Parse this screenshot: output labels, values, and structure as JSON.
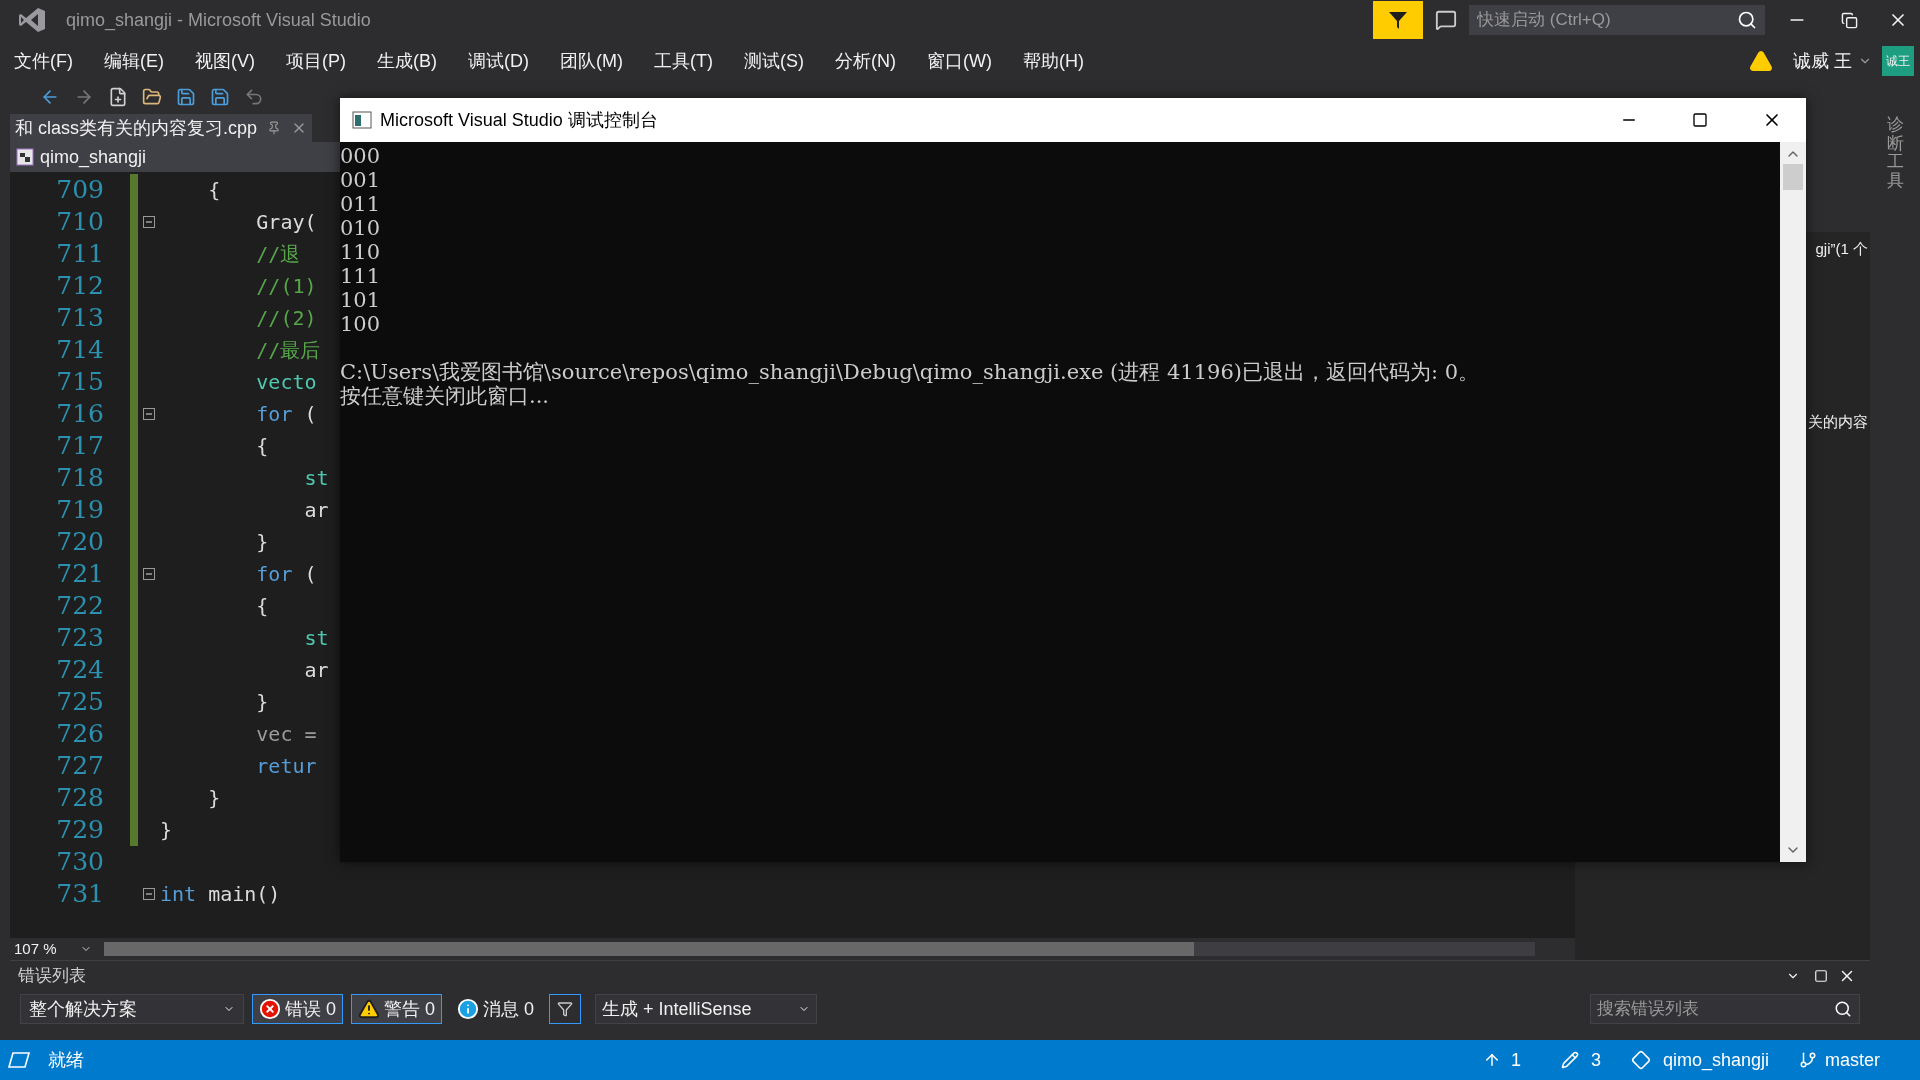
{
  "window": {
    "title": "qimo_shangji - Microsoft Visual Studio"
  },
  "quick_launch": {
    "placeholder": "快速启动 (Ctrl+Q)"
  },
  "menu": [
    "文件(F)",
    "编辑(E)",
    "视图(V)",
    "项目(P)",
    "生成(B)",
    "调试(D)",
    "团队(M)",
    "工具(T)",
    "测试(S)",
    "分析(N)",
    "窗口(W)",
    "帮助(H)"
  ],
  "user": {
    "name": "诚威 王",
    "avatar": "诚王"
  },
  "editor": {
    "tab": {
      "label": "和 class类有关的内容复习.cpp",
      "selected": true
    },
    "project": "qimo_shangji",
    "zoom": "107 %",
    "lines": [
      {
        "number": "709",
        "fold": false,
        "segments": [
          {
            "text": "    {",
            "kind": "plain"
          }
        ]
      },
      {
        "number": "710",
        "fold": true,
        "segments": [
          {
            "text": "        Gray(",
            "kind": "plain"
          }
        ]
      },
      {
        "number": "711",
        "fold": false,
        "segments": [
          {
            "text": "        //退",
            "kind": "comment"
          }
        ]
      },
      {
        "number": "712",
        "fold": false,
        "segments": [
          {
            "text": "        //(1)",
            "kind": "comment"
          }
        ]
      },
      {
        "number": "713",
        "fold": false,
        "segments": [
          {
            "text": "        //(2)",
            "kind": "comment"
          }
        ]
      },
      {
        "number": "714",
        "fold": false,
        "segments": [
          {
            "text": "        //最后",
            "kind": "comment"
          }
        ]
      },
      {
        "number": "715",
        "fold": false,
        "segments": [
          {
            "text": "        vecto",
            "kind": "type"
          }
        ]
      },
      {
        "number": "716",
        "fold": true,
        "segments": [
          {
            "text": "        for",
            "kind": "keyword"
          },
          {
            "text": " (",
            "kind": "plain"
          }
        ]
      },
      {
        "number": "717",
        "fold": false,
        "segments": [
          {
            "text": "        {",
            "kind": "plain"
          }
        ]
      },
      {
        "number": "718",
        "fold": false,
        "segments": [
          {
            "text": "            st",
            "kind": "type"
          }
        ]
      },
      {
        "number": "719",
        "fold": false,
        "segments": [
          {
            "text": "            ar",
            "kind": "plain"
          }
        ]
      },
      {
        "number": "720",
        "fold": false,
        "segments": [
          {
            "text": "        }",
            "kind": "plain"
          }
        ]
      },
      {
        "number": "721",
        "fold": true,
        "segments": [
          {
            "text": "        for",
            "kind": "keyword"
          },
          {
            "text": " (",
            "kind": "plain"
          }
        ]
      },
      {
        "number": "722",
        "fold": false,
        "segments": [
          {
            "text": "        {",
            "kind": "plain"
          }
        ]
      },
      {
        "number": "723",
        "fold": false,
        "segments": [
          {
            "text": "            st",
            "kind": "type"
          }
        ]
      },
      {
        "number": "724",
        "fold": false,
        "segments": [
          {
            "text": "            ar",
            "kind": "plain"
          }
        ]
      },
      {
        "number": "725",
        "fold": false,
        "segments": [
          {
            "text": "        }",
            "kind": "plain"
          }
        ]
      },
      {
        "number": "726",
        "fold": false,
        "segments": [
          {
            "text": "        vec =",
            "kind": "dim"
          }
        ]
      },
      {
        "number": "727",
        "fold": false,
        "segments": [
          {
            "text": "        retur",
            "kind": "keyword"
          }
        ]
      },
      {
        "number": "728",
        "fold": false,
        "segments": [
          {
            "text": "    }",
            "kind": "plain"
          }
        ]
      },
      {
        "number": "729",
        "fold": false,
        "segments": [
          {
            "text": "}",
            "kind": "plain"
          }
        ]
      },
      {
        "number": "730",
        "fold": false
      },
      {
        "number": "731",
        "fold": true,
        "segments": [
          {
            "text": "int",
            "kind": "keyword"
          },
          {
            "text": " main()",
            "kind": "plain"
          }
        ]
      }
    ]
  },
  "console": {
    "title": "Microsoft Visual Studio 调试控制台",
    "lines": [
      "000",
      "001",
      "011",
      "010",
      "110",
      "111",
      "101",
      "100"
    ],
    "exit_lines": [
      "C:\\Users\\我爱图书馆\\source\\repos\\qimo_shangji\\Debug\\qimo_shangji.exe (进程 41196)已退出，返回代码为: 0。",
      "按任意键关闭此窗口..."
    ]
  },
  "side_panel": {
    "texts": [
      "gji”(1 个",
      "关的内容"
    ],
    "vertical_tab": "诊断工具"
  },
  "error_list": {
    "title": "错误列表",
    "scope": "整个解决方案",
    "filters": [
      {
        "kind": "error",
        "label": "错误 0",
        "selected": true
      },
      {
        "kind": "warning",
        "label": "警告 0",
        "selected": true
      },
      {
        "kind": "info",
        "label": "消息 0",
        "selected": false
      }
    ],
    "source": "生成 + IntelliSense",
    "search": {
      "placeholder": "搜索错误列表"
    }
  },
  "status_bar": {
    "text": "就绪",
    "pushes": "1",
    "changes": "3",
    "repo": "qimo_shangji",
    "branch": "master"
  }
}
